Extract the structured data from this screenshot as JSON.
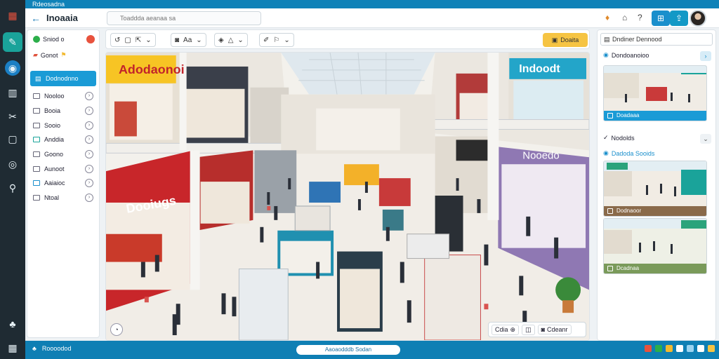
{
  "topbar": {
    "title": "Rdeosadna"
  },
  "header": {
    "app_title": "Inoaaia",
    "search_placeholder": "Toaddda aeanaa sa",
    "icons": [
      "bell-icon",
      "home-icon",
      "help-icon",
      "grid-icon",
      "share-icon",
      "settings-icon"
    ]
  },
  "rail": {
    "icons": [
      "logo-icon",
      "edit-icon",
      "globe-icon",
      "building-icon",
      "tools-icon",
      "document-icon",
      "bolt-icon",
      "wrench-icon",
      "people-icon",
      "apps-icon"
    ]
  },
  "sidebar": {
    "top1": "Sniod o",
    "top2": "Gonot",
    "active": "Dodnodnno",
    "items": [
      {
        "label": "Nooloo"
      },
      {
        "label": "Booia"
      },
      {
        "label": "Sooio"
      },
      {
        "label": "Anddia"
      },
      {
        "label": "Goono"
      },
      {
        "label": "Aunoot"
      },
      {
        "label": "Aaiaioc"
      },
      {
        "label": "Ntoal"
      }
    ]
  },
  "toolbar": {
    "primary_label": "Doaita"
  },
  "viewport": {
    "chip1_label": "Cdia",
    "chip2_label": "Cdeanr",
    "store_signs": [
      "Adodaonoi",
      "Indoodt",
      "Dooiugs",
      "Nooedo"
    ]
  },
  "rpanel": {
    "search_text": "Dndiner Dennood",
    "section1_title": "Dondoanoioo",
    "thumb1_label": "Doadaaa",
    "section2_title": "Nodolds",
    "section2_sub": "Dadoda Sooids",
    "thumb2_label": "Dodnaoor",
    "thumb3_label": "Dcadnaa"
  },
  "status": {
    "left_label": "Roooodod",
    "pill": "Aaoaodddb Sodan"
  },
  "colors": {
    "accent": "#1a9bd6",
    "rail": "#1f2b33",
    "status_bar": "#0f7fb4",
    "primary_button": "#f6c443",
    "active_rail": "#1aa39a"
  }
}
